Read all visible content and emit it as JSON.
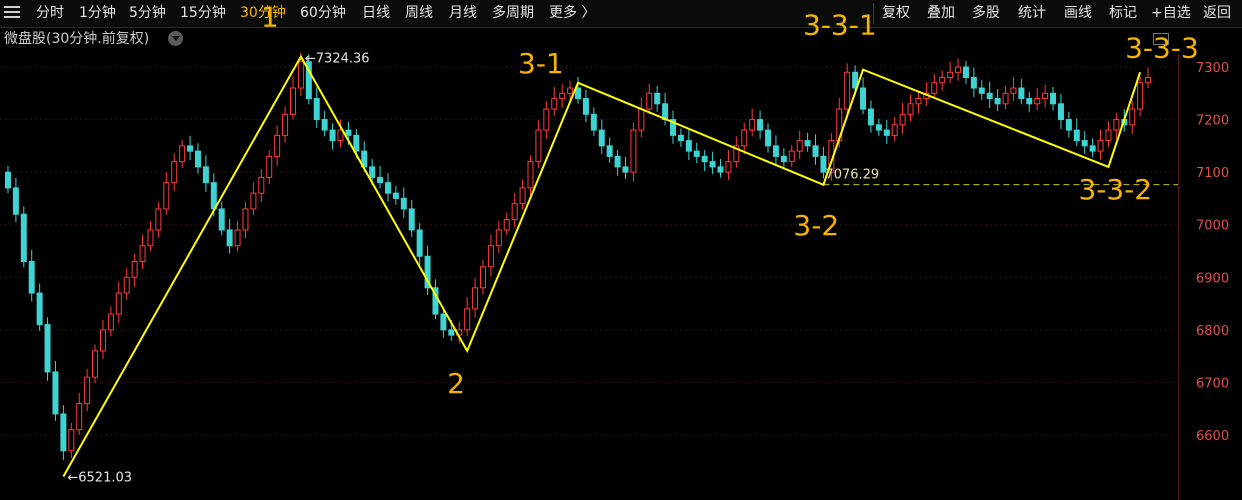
{
  "toolbar": {
    "periods": [
      "分时",
      "1分钟",
      "5分钟",
      "15分钟",
      "30分钟",
      "60分钟",
      "日线",
      "周线",
      "月线",
      "多周期",
      "更多 〉"
    ],
    "active_period": "30分钟",
    "tools": [
      "复权",
      "叠加",
      "多股",
      "统计",
      "画线",
      "标记",
      "+自选",
      "返回"
    ]
  },
  "chart_header": {
    "title": "微盘股(30分钟.前复权)"
  },
  "colors": {
    "up": "#ff3b3b",
    "down": "#3fd3d3",
    "wave_line": "#ffff00",
    "annotation": "#f5b400",
    "axis_text": "#e05050",
    "grid": "#3a0f0f"
  },
  "chart_data": {
    "type": "candlestick",
    "y_axis_ticks": [
      7300,
      7200,
      7100,
      7000,
      6900,
      6800,
      6700,
      6600
    ],
    "ylim": [
      6510,
      7335
    ],
    "grid": true,
    "max_label": "7324.36",
    "min_label": "6521.03",
    "support_label": "7076.29",
    "support_level": 7076.29,
    "wave_points": [
      {
        "label": "",
        "bar": 7,
        "value": 6521
      },
      {
        "label": "1",
        "bar": 37,
        "value": 7320
      },
      {
        "label": "2",
        "bar": 58,
        "value": 6760
      },
      {
        "label": "3-1",
        "bar": 72,
        "value": 7270
      },
      {
        "label": "3-2",
        "bar": 103,
        "value": 7076
      },
      {
        "label": "3-3-1",
        "bar": 108,
        "value": 7295
      },
      {
        "label": "3-3-2",
        "bar": 139,
        "value": 7110
      },
      {
        "label": "3-3-3",
        "bar": 143,
        "value": 7290
      }
    ],
    "close": [
      7070,
      7020,
      6930,
      6870,
      6810,
      6720,
      6640,
      6570,
      6610,
      6660,
      6710,
      6760,
      6800,
      6830,
      6870,
      6900,
      6930,
      6960,
      6990,
      7030,
      7080,
      7120,
      7150,
      7140,
      7110,
      7080,
      7030,
      6990,
      6960,
      6990,
      7030,
      7060,
      7090,
      7130,
      7170,
      7210,
      7260,
      7310,
      7240,
      7200,
      7180,
      7160,
      7180,
      7170,
      7140,
      7110,
      7090,
      7080,
      7060,
      7050,
      7030,
      6990,
      6940,
      6880,
      6830,
      6800,
      6790,
      6800,
      6840,
      6880,
      6920,
      6960,
      6990,
      7010,
      7040,
      7070,
      7120,
      7180,
      7220,
      7240,
      7250,
      7260,
      7240,
      7210,
      7180,
      7150,
      7130,
      7110,
      7100,
      7180,
      7220,
      7250,
      7230,
      7200,
      7170,
      7160,
      7140,
      7130,
      7120,
      7110,
      7100,
      7120,
      7150,
      7180,
      7200,
      7180,
      7150,
      7130,
      7120,
      7140,
      7160,
      7150,
      7130,
      7100,
      7160,
      7220,
      7290,
      7260,
      7220,
      7190,
      7180,
      7170,
      7190,
      7210,
      7230,
      7240,
      7250,
      7270,
      7280,
      7290,
      7300,
      7280,
      7260,
      7250,
      7240,
      7230,
      7250,
      7260,
      7240,
      7230,
      7240,
      7250,
      7230,
      7200,
      7180,
      7160,
      7150,
      7140,
      7160,
      7180,
      7200,
      7190,
      7220,
      7270,
      7280
    ]
  }
}
